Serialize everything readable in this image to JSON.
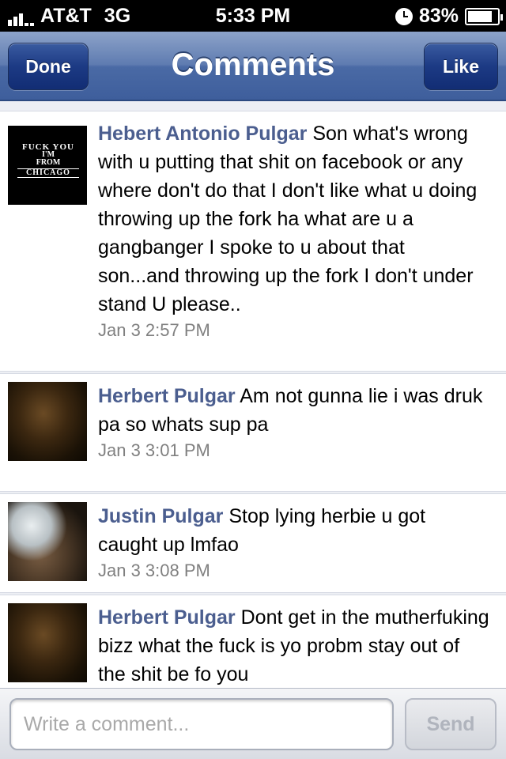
{
  "status_bar": {
    "carrier": "AT&T",
    "network": "3G",
    "time": "5:33 PM",
    "battery": "83%",
    "battery_level": 0.83,
    "icons": [
      "signal-icon",
      "clock-icon",
      "battery-icon"
    ]
  },
  "nav": {
    "title": "Comments",
    "left_button": "Done",
    "right_button": "Like",
    "accent_color": "#3e5e9c"
  },
  "comments": [
    {
      "author": "Hebert Antonio Pulgar",
      "text": "Son what's wrong with u putting that shit on facebook or any where don't do that I don't like what u doing throwing up the fork ha what are u a gangbanger I spoke to u  about that son...and throwing up the fork I don't under stand U please..",
      "time": "Jan 3 2:57 PM",
      "avatar_text": [
        "FUCK YOU",
        "I'M",
        "FROM",
        "CHICAGO"
      ]
    },
    {
      "author": "Herbert Pulgar",
      "text": "Am not gunna lie i was druk pa so whats sup pa",
      "time": "Jan 3 3:01 PM"
    },
    {
      "author": "Justin Pulgar",
      "text": "Stop lying herbie u got caught up lmfao",
      "time": "Jan 3 3:08 PM"
    },
    {
      "author": "Herbert Pulgar",
      "text": "Dont get in the mutherfuking bizz what the fuck is yo probm stay out of the shit be fo you",
      "time": ""
    }
  ],
  "composer": {
    "placeholder": "Write a comment...",
    "value": "",
    "send_label": "Send"
  }
}
